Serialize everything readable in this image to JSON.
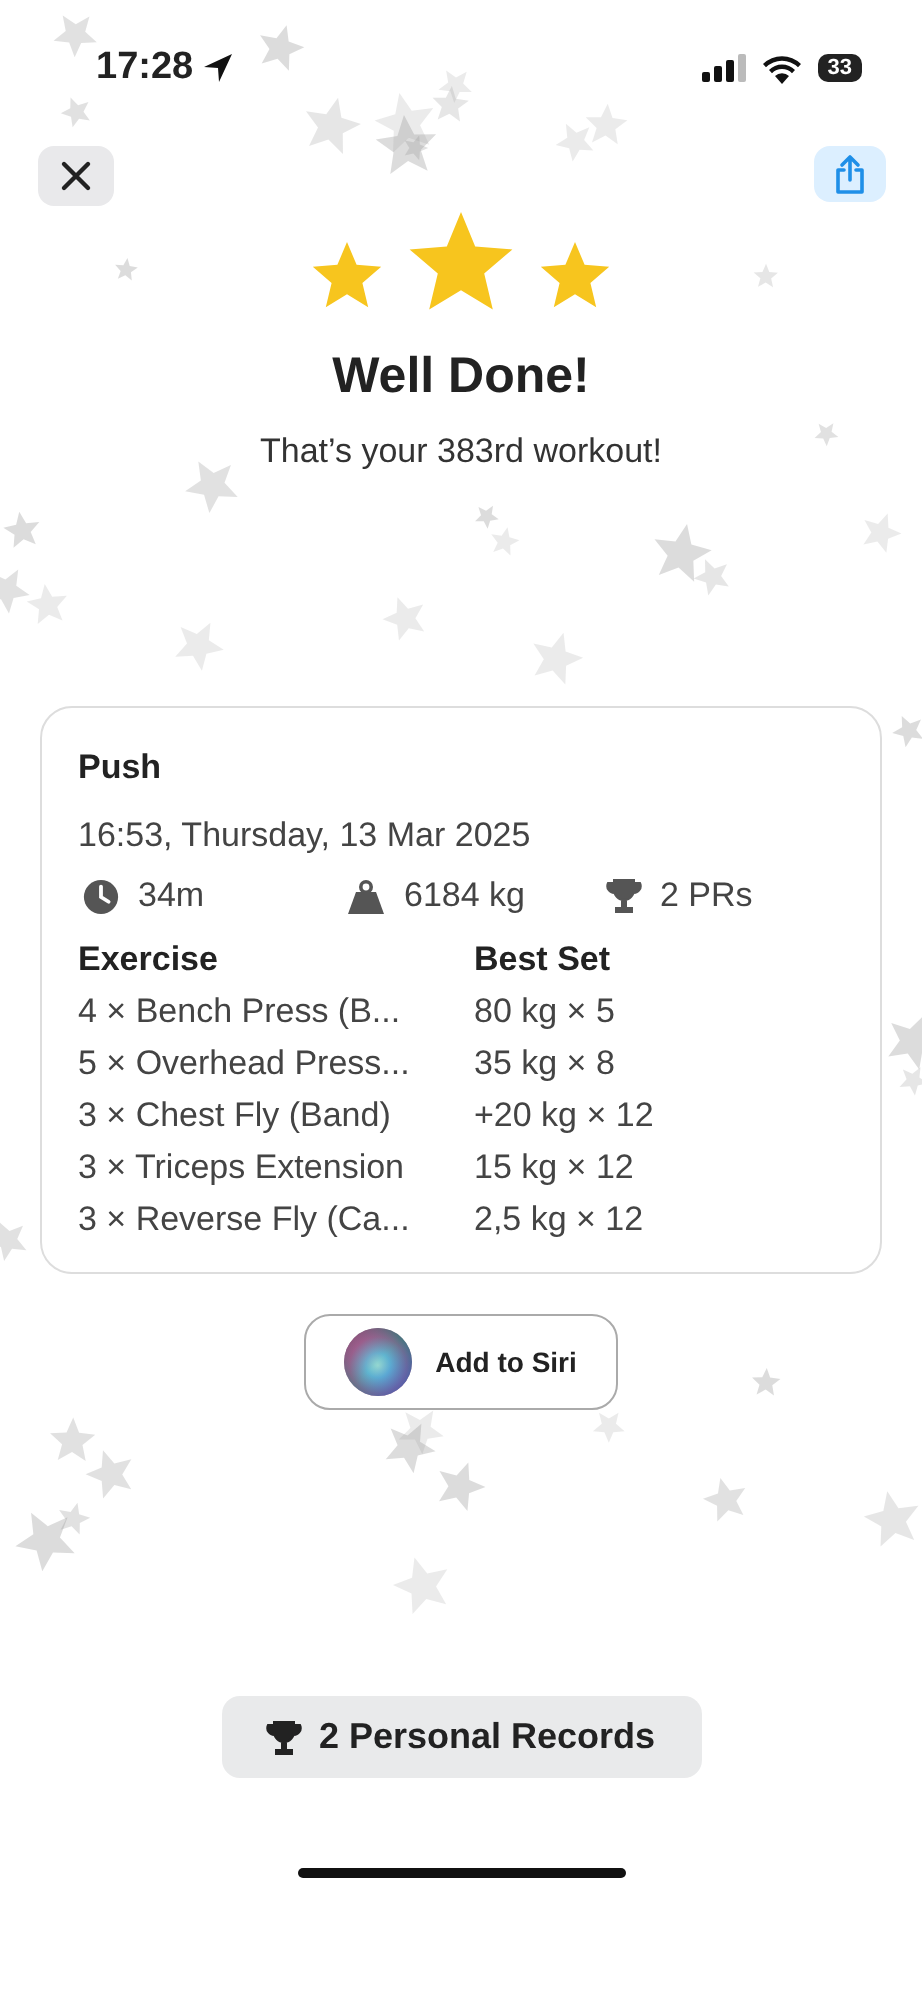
{
  "status_bar": {
    "time": "17:28",
    "battery": "33"
  },
  "celebration": {
    "stars": 3,
    "title": "Well Done!",
    "subtitle": "That’s your 383rd workout!"
  },
  "workout": {
    "name": "Push",
    "date": "16:53, Thursday, 13 Mar 2025",
    "stats": [
      {
        "kind": "duration",
        "value": "34m"
      },
      {
        "kind": "volume",
        "value": "6184 kg"
      },
      {
        "kind": "records",
        "value": "2 PRs"
      }
    ],
    "columns": [
      "Exercise",
      "Best Set"
    ],
    "rows": [
      [
        "4 × Bench Press (B...",
        "80 kg × 5"
      ],
      [
        "5 × Overhead Press...",
        "35 kg × 8"
      ],
      [
        "3 × Chest Fly (Band)",
        "+20 kg × 12"
      ],
      [
        "3 × Triceps Extension",
        "15 kg × 12"
      ],
      [
        "3 × Reverse Fly (Ca...",
        "2,5 kg × 12"
      ]
    ]
  },
  "siri_button": "Add to Siri",
  "records_button": "2 Personal Records"
}
